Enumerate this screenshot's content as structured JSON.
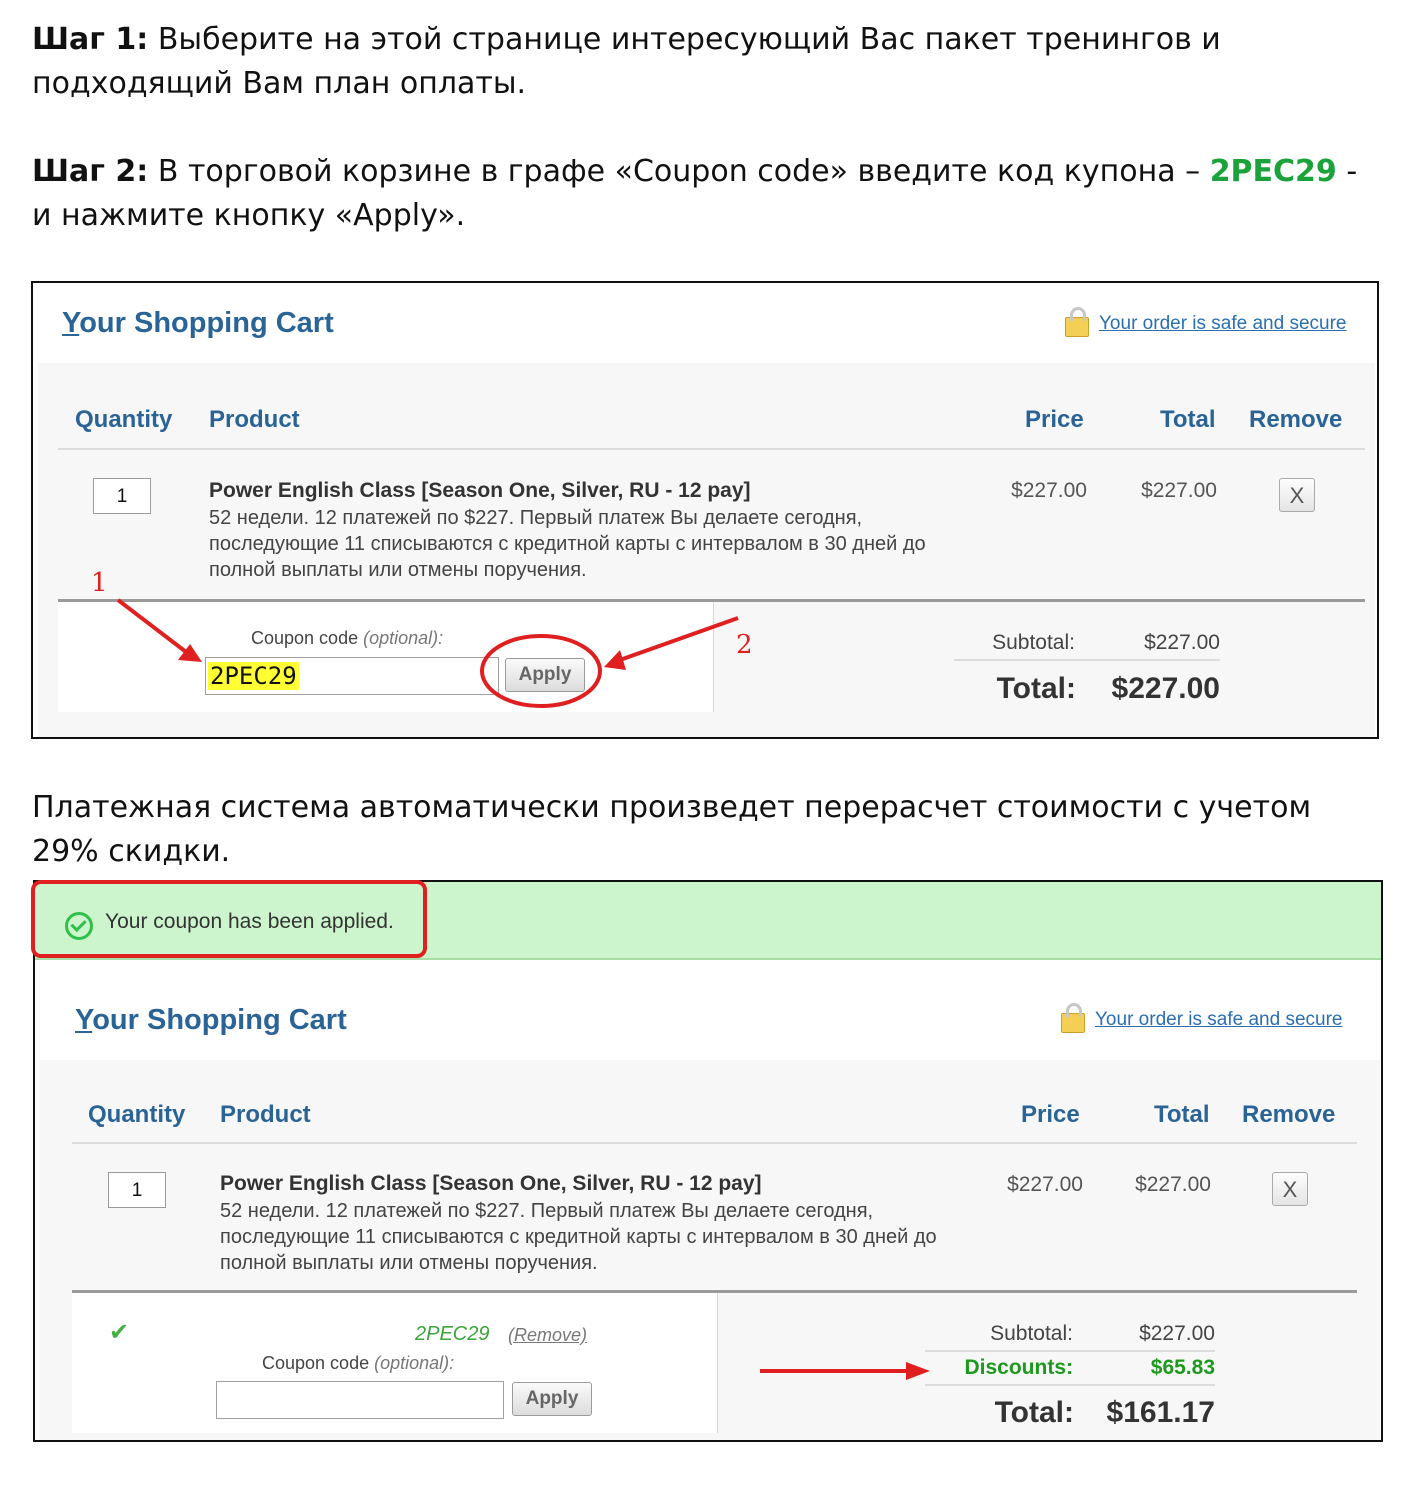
{
  "step1": {
    "label": "Шаг 1:",
    "text": " Выберите на этой странице интересующий Вас пакет тренингов и подходящий Вам план оплаты."
  },
  "step2": {
    "label": "Шаг 2:",
    "text_before": " В торговой корзине в графе «Coupon code» введите код купона – ",
    "code": "2PEC29",
    "text_after": " - и нажмите кнопку «Apply»."
  },
  "note": "Платежная система автоматически произведет перерасчет  стоимости с учетом 29% скидки.",
  "colors": {
    "title_blue": "#2a6496",
    "link_blue": "#2a6fb0",
    "accent_green": "#1aa33a",
    "annotation_red": "#e02020",
    "notice_green": "#cdf5cd"
  },
  "cart1": {
    "title_first": "Y",
    "title_rest": "our Shopping Cart",
    "secure_link": "Your order is safe and secure",
    "lock_icon": "lock-icon",
    "headers": {
      "quantity": "Quantity",
      "product": "Product",
      "price": "Price",
      "total": "Total",
      "remove": "Remove"
    },
    "item": {
      "qty": "1",
      "name": "Power English Class [Season One, Silver, RU - 12 pay]",
      "desc": "52 недели. 12 платежей по $227. Первый платеж Вы делаете сегодня, последующие 11 списываются с кредитной карты с интервалом в 30 дней до полной выплаты или отмены поручения.",
      "price": "$227.00",
      "total": "$227.00",
      "remove_symbol": "X"
    },
    "coupon_label": "Coupon code ",
    "coupon_optional": "(optional):",
    "coupon_value": "2PEC29",
    "apply_label": "Apply",
    "subtotal_label": "Subtotal:",
    "subtotal_value": "$227.00",
    "total_label": "Total:",
    "total_value": "$227.00",
    "annotation_1": "1",
    "annotation_2": "2"
  },
  "cart2": {
    "notice": "Your coupon has been applied.",
    "title_first": "Y",
    "title_rest": "our Shopping Cart",
    "secure_link": "Your order is safe and secure",
    "headers": {
      "quantity": "Quantity",
      "product": "Product",
      "price": "Price",
      "total": "Total",
      "remove": "Remove"
    },
    "item": {
      "qty": "1",
      "name": "Power English Class [Season One, Silver, RU - 12 pay]",
      "desc": "52 недели. 12 платежей по $227. Первый платеж Вы делаете сегодня, последующие 11 списываются с кредитной карты с интервалом в 30 дней до полной выплаты или отмены поручения.",
      "price": "$227.00",
      "total": "$227.00",
      "remove_symbol": "X"
    },
    "applied_code": "2PEC29",
    "remove_link": "(Remove)",
    "coupon_label": "Coupon code ",
    "coupon_optional": "(optional):",
    "coupon_value": "",
    "apply_label": "Apply",
    "subtotal_label": "Subtotal:",
    "subtotal_value": "$227.00",
    "discounts_label": "Discounts:",
    "discounts_value": "$65.83",
    "total_label": "Total:",
    "total_value": "$161.17"
  }
}
